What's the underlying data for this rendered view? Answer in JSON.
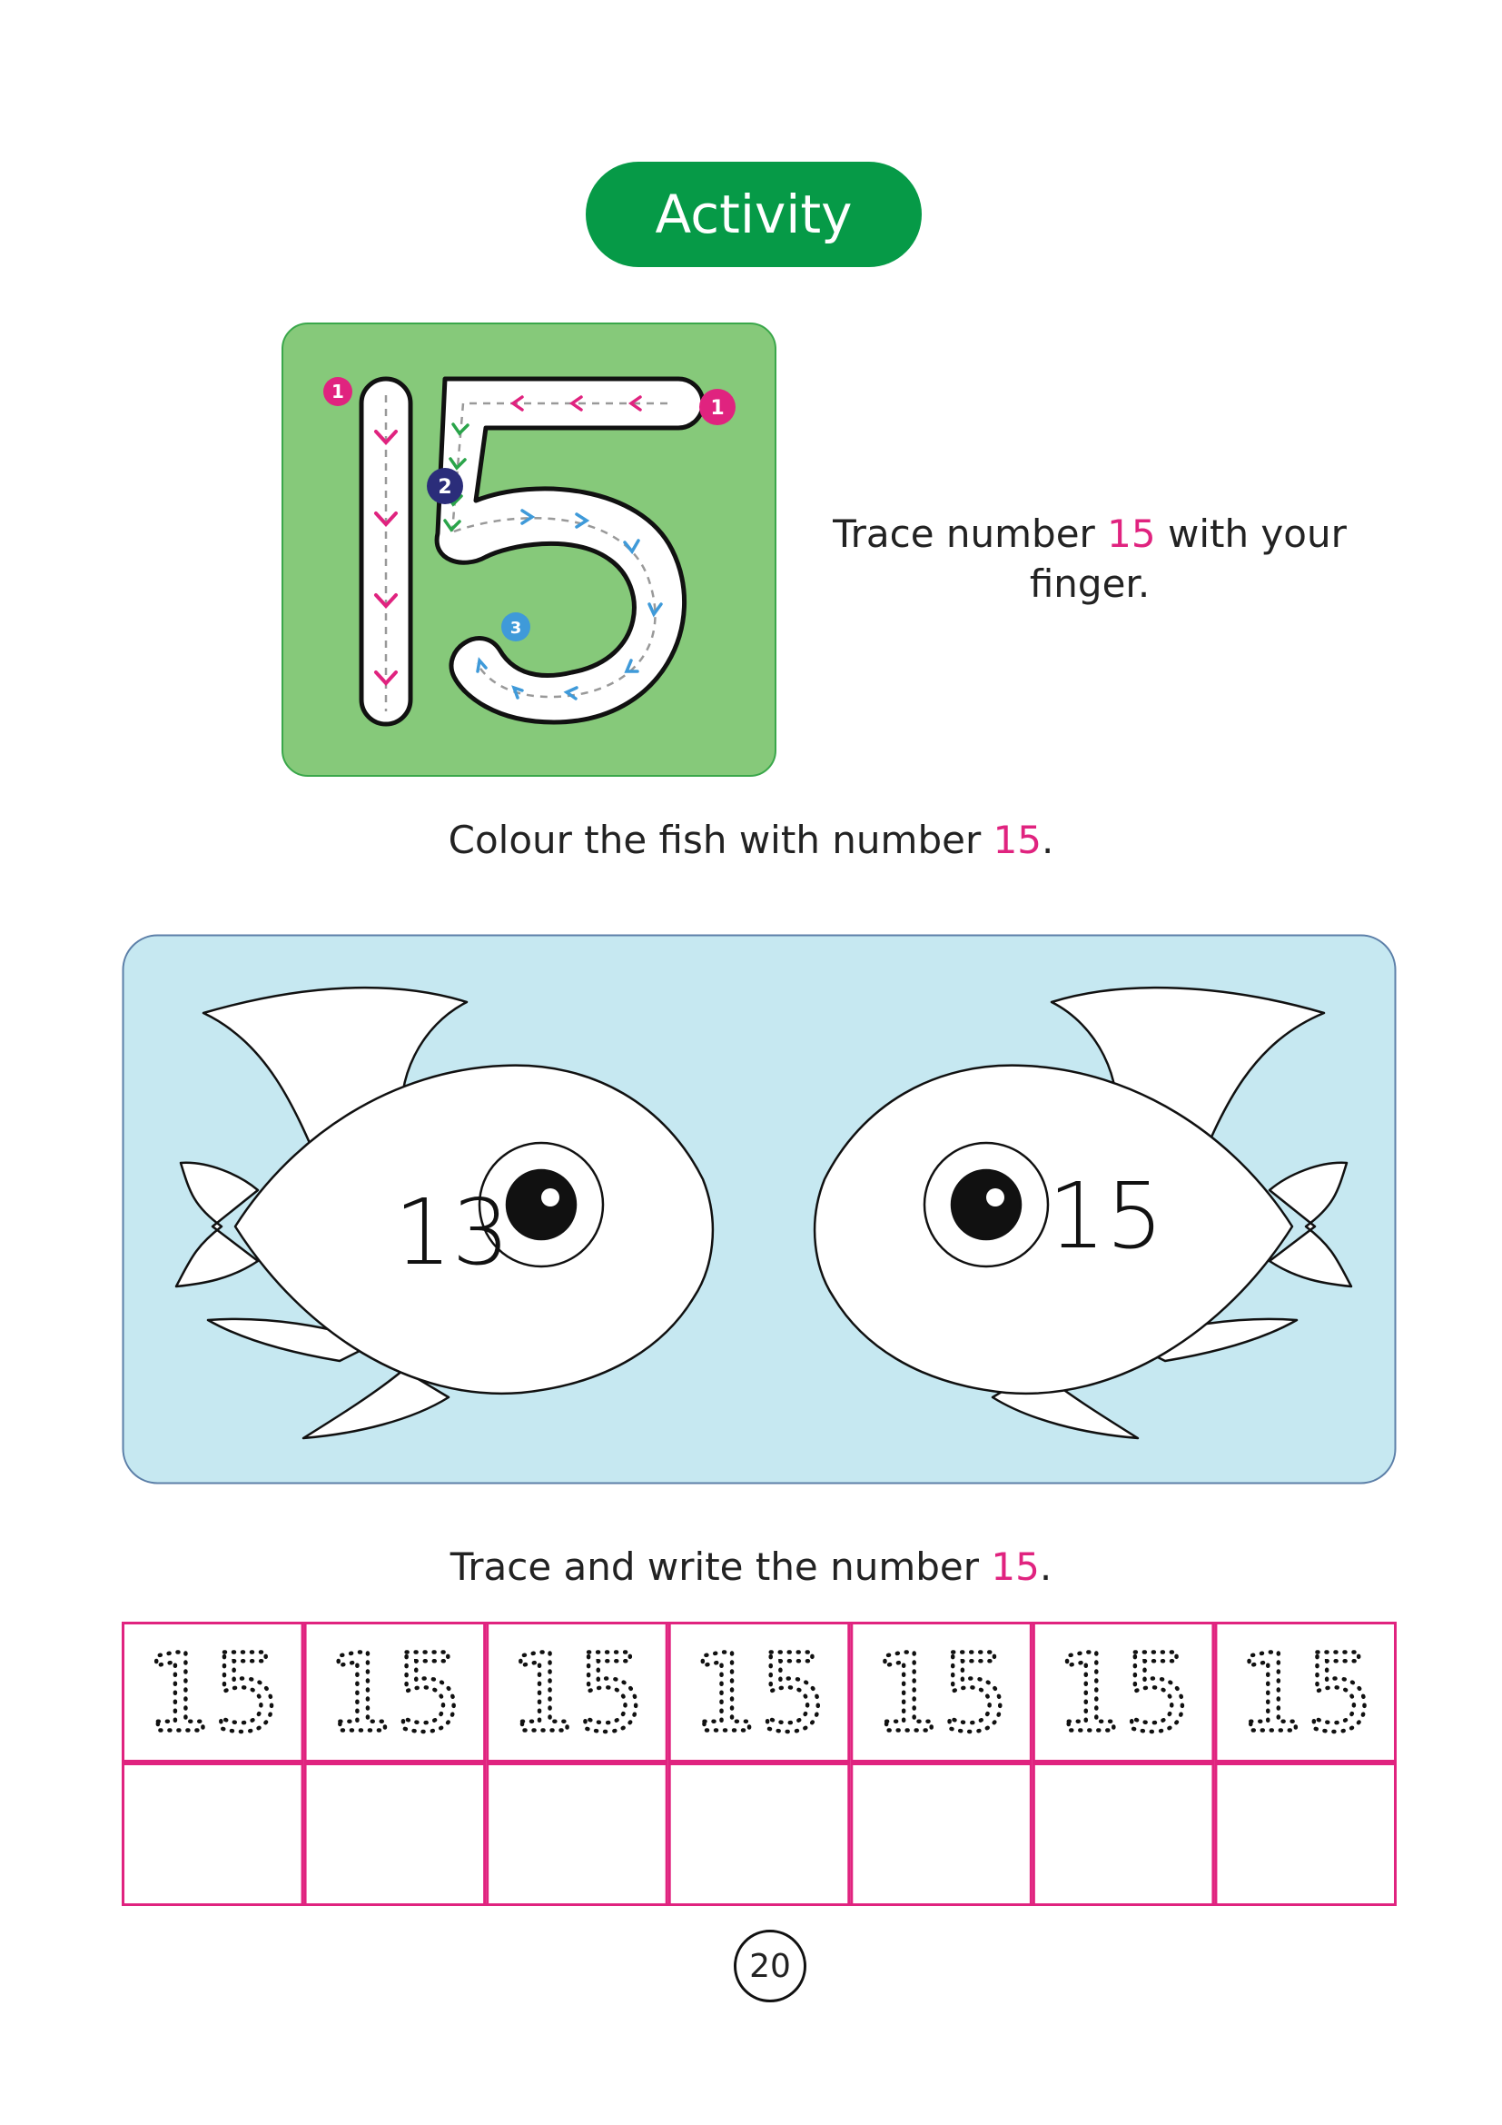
{
  "header": {
    "activity_label": "Activity"
  },
  "trace_section": {
    "big_number": "15",
    "stroke_badges": [
      "1",
      "2",
      "3",
      "1"
    ],
    "instruction_before": "Trace number ",
    "instruction_number": "15",
    "instruction_after": " with your finger."
  },
  "colour_section": {
    "instruction_before": "Colour the fish with number ",
    "instruction_number": "15",
    "instruction_after": ".",
    "fish": [
      {
        "number": "13"
      },
      {
        "number": "15"
      }
    ]
  },
  "write_section": {
    "instruction_before": "Trace and write the number ",
    "instruction_number": "15",
    "instruction_after": ".",
    "trace_cells": [
      "15",
      "15",
      "15",
      "15",
      "15",
      "15",
      "15"
    ],
    "empty_cells": 7
  },
  "footer": {
    "page_number": "20"
  },
  "colors": {
    "green": "#069a47",
    "card_green": "#86c97a",
    "pink": "#e0237f",
    "panel_blue": "#c6e8f1",
    "navy": "#2b2d7a",
    "light_blue": "#3f9ad9"
  }
}
